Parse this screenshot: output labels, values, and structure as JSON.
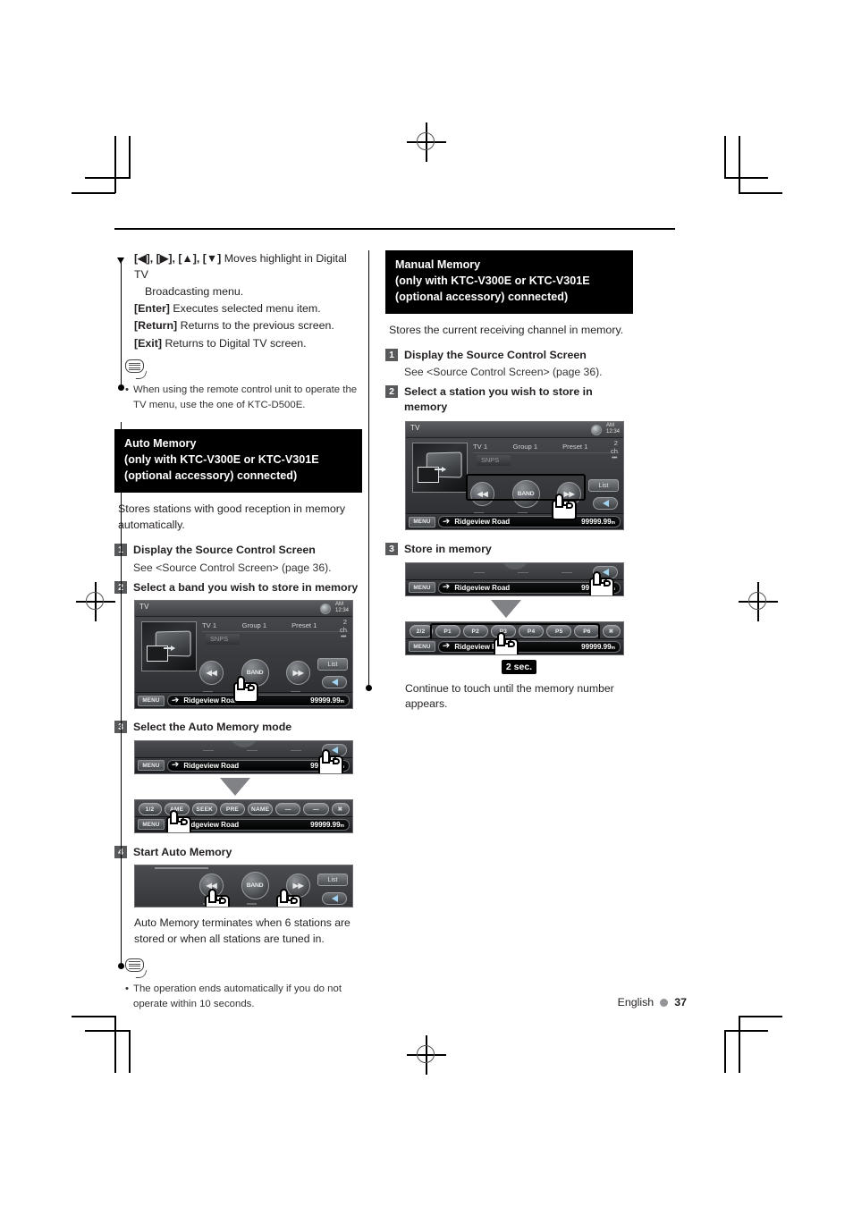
{
  "meta": {
    "footer_language": "English",
    "page_number": "37"
  },
  "left_column": {
    "key_list": [
      {
        "keys": "[◀], [▶], [▲], [▼]",
        "desc": "Moves highlight in Digital TV",
        "desc2": "Broadcasting menu."
      },
      {
        "keys": "[Enter]",
        "desc": "Executes selected menu item.",
        "desc2": ""
      },
      {
        "keys": "[Return]",
        "desc": "Returns to the previous screen.",
        "desc2": ""
      },
      {
        "keys": "[Exit]",
        "desc": "Returns to Digital TV screen.",
        "desc2": ""
      }
    ],
    "note": {
      "icon": "note-bubble-icon",
      "bullet": "•",
      "text": "When using the remote control unit to operate the TV menu, use the one of KTC-D500E."
    },
    "section": {
      "heading_line1": "Auto Memory",
      "heading_line2": "(only with KTC-V300E or KTC-V301E",
      "heading_line3": "(optional accessory) connected)",
      "intro": "Stores stations with good reception in memory automatically.",
      "steps": [
        {
          "num": "1",
          "title": "Display the Source Control Screen",
          "sub": "See <Source Control Screen> (page 36)."
        },
        {
          "num": "2",
          "title": "Select a band you wish to store in memory",
          "sub": ""
        },
        {
          "num": "3",
          "title": "Select the Auto Memory mode",
          "sub": ""
        },
        {
          "num": "4",
          "title": "Start Auto Memory",
          "sub": ""
        }
      ],
      "after_text": "Auto Memory terminates when 6 stations are stored or when all stations are tuned in."
    },
    "note2": {
      "icon": "note-bubble-icon",
      "bullet": "•",
      "text": "The operation ends automatically if you do not operate within 10 seconds."
    }
  },
  "right_column": {
    "section": {
      "heading_line1": "Manual Memory",
      "heading_line2": "(only with KTC-V300E or KTC-V301E",
      "heading_line3": "(optional accessory) connected)",
      "intro": "Stores the current receiving channel in memory.",
      "steps": [
        {
          "num": "1",
          "title": "Display the Source Control Screen",
          "sub": "See <Source Control Screen> (page 36)."
        },
        {
          "num": "2",
          "title": "Select a station you wish to store in memory",
          "sub": ""
        },
        {
          "num": "3",
          "title": "Store in memory",
          "sub": ""
        }
      ],
      "badge": "2 sec.",
      "after_text": "Continue to touch until the memory number appears."
    }
  },
  "device_screen": {
    "source_label": "TV",
    "clock_ampm": "AM",
    "clock_time": "12:34",
    "info": {
      "band": "TV 1",
      "group": "Group 1",
      "preset": "Preset  1",
      "channel": "2 ch"
    },
    "subtitle": "SNPS",
    "dots": "•••",
    "buttons": {
      "prev": "◀◀",
      "band": "BAND",
      "next": "▶▶",
      "list": "List",
      "menu": "MENU"
    },
    "nav": {
      "road": "Ridgeview Road",
      "distance": "99999.99",
      "unit": "m"
    },
    "function_bar": {
      "page_indicator": "1/2",
      "items": [
        "AME",
        "SEEK",
        "PRE",
        "NAME",
        "—",
        "—"
      ],
      "close": "✖"
    },
    "preset_bar": {
      "page_indicator": "2/2",
      "items": [
        "P1",
        "P2",
        "P3",
        "P4",
        "P5",
        "P6"
      ],
      "close": "✖"
    }
  }
}
